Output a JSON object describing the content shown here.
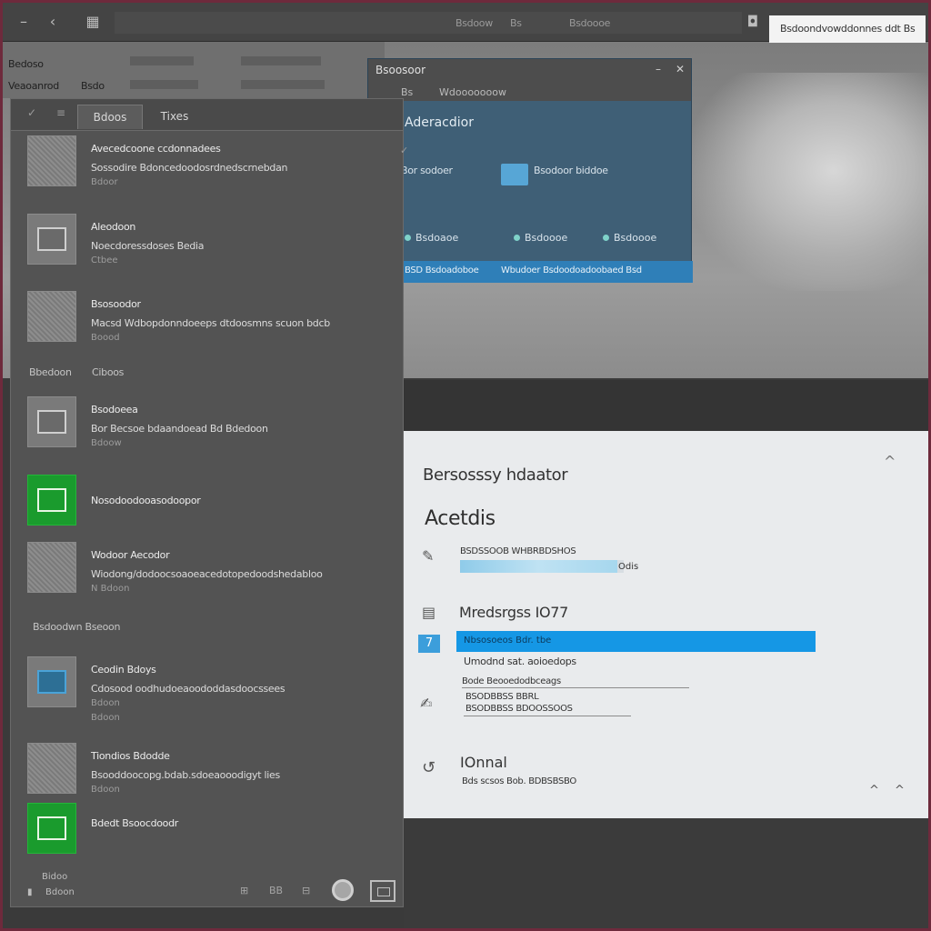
{
  "topbar": {
    "left_glyph": "‹",
    "texts": [
      "Bsdoow",
      "Bs",
      "Bsdoooe"
    ],
    "search_text": "Bsdoondvowddonnes ddt Bs"
  },
  "background": {
    "strip_texts": [
      "Bedoso",
      "Veaoanrod",
      "Bsdo"
    ]
  },
  "left_panel": {
    "tabs": [
      "Bdoos",
      "Tixes"
    ],
    "items": [
      {
        "title": "Avecedcoone ccdonnadees",
        "desc": "Sossodire Bdoncedoodosrdnedscrnebdan",
        "sub": "Bdoor"
      },
      {
        "title": "Aleodoon",
        "desc": "Noecdoressdoses Bedia",
        "sub": "Ctbee"
      },
      {
        "title": "Bsosoodor",
        "desc": "Macsd Wdbopdonndoeeps dtdoosmns scuon bdcb",
        "sub": "Boood"
      },
      {
        "title": "Bsodoeea",
        "desc": "Bor Becsoe bdaandoead Bd Bdedoon",
        "sub": "Bdoow"
      },
      {
        "title": "Nosodoodooasodoopor"
      },
      {
        "title": "Wodoor Aecodor",
        "desc": "Wiodong/dodoocsoaoeacedotopedoodshedabloo",
        "sub": "N Bdoon"
      },
      {
        "title": "Ceodin Bdoys",
        "desc": "Cdosood oodhudoeaoododdasdoocssees",
        "sub": "Bdoon",
        "sub2": "Bdoon"
      },
      {
        "title": "Tiondios Bdodde",
        "desc": "Bsooddoocopg.bdab.sdoeaooodigyt lies",
        "sub": "Bdoon"
      },
      {
        "title": "Bdedt Bsoocdoodr"
      }
    ],
    "sections": [
      "Bbedoon",
      "Ciboos",
      "Bsdoodwn Bseoon"
    ],
    "footer": {
      "line1": "Bidoo",
      "line2": "Bdoon",
      "icons": [
        "⊞",
        "BB",
        "⊟"
      ]
    }
  },
  "blue_window": {
    "title": "Bsoosoor",
    "sub1": "Bs",
    "sub2": "Wdooooooow",
    "heading": "Aderacdior",
    "left_label": "Bor sodoer",
    "folder_label": "Bsodoor biddoe",
    "links": [
      "Bsdoaoe",
      "Bsdoooe",
      "Bsdoooe"
    ],
    "status_left": "BSD Bsdoadoboe",
    "status_right": "Wbudoer Bsdoodoadoobaed Bsd"
  },
  "settings": {
    "title": "Bersosssy hdaator",
    "subtitle": "Acetdis",
    "row1_label": "BSDSSOOB WHBRBDSHOS",
    "progress_percent": 96,
    "progress_value": "Odis",
    "h2": "Mredsrgss IO77",
    "badge": "7",
    "highlight_text": "Nbsosoeos Bdr. tbe",
    "note": "Umodnd sat. aoioedops",
    "field1": "Bode Beooedodbceags",
    "field2": "BSODBBSS BBRL",
    "field3": "BSODBBSS BDOOSSOOS",
    "h3": "IOnnal",
    "footnote": "Bds scsos Bob. BDBSBSBO",
    "caret_up": "^",
    "corner_icons": [
      "^",
      "^"
    ]
  }
}
